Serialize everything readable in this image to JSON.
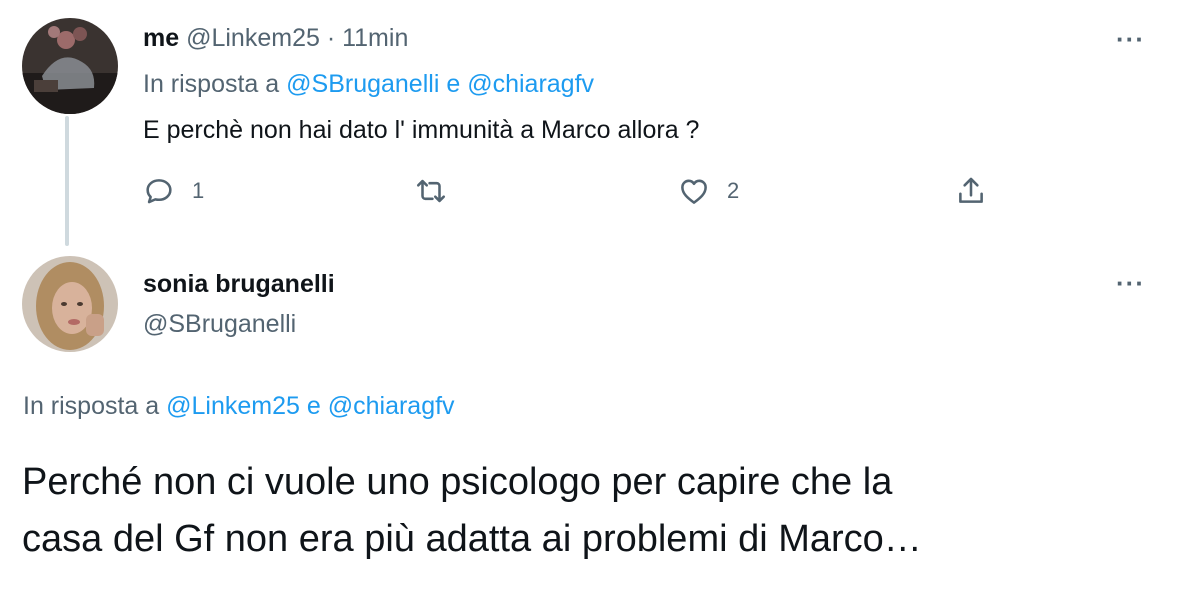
{
  "tweet1": {
    "display_name": "me",
    "handle": "@Linkem25",
    "separator": "·",
    "time": "11min",
    "reply_prefix": "In risposta a",
    "reply_to_1": "@SBruganelli",
    "reply_and": "e",
    "reply_to_2": "@chiaragfv",
    "text": "E perchè non hai dato l' immunità a Marco allora ?",
    "reply_count": "1",
    "like_count": "2",
    "more_label": "···"
  },
  "tweet2": {
    "display_name": "sonia bruganelli",
    "handle": "@SBruganelli",
    "more_label": "···",
    "reply_prefix": "In risposta a",
    "reply_to_1": "@Linkem25",
    "reply_and": "e",
    "reply_to_2": "@chiaragfv",
    "text_line1": "Perché non ci vuole uno psicologo per capire che la",
    "text_line2": "casa del Gf non era più adatta ai problemi di Marco…"
  },
  "colors": {
    "link": "#1d9bf0",
    "muted": "#536471",
    "text": "#0f1419"
  }
}
